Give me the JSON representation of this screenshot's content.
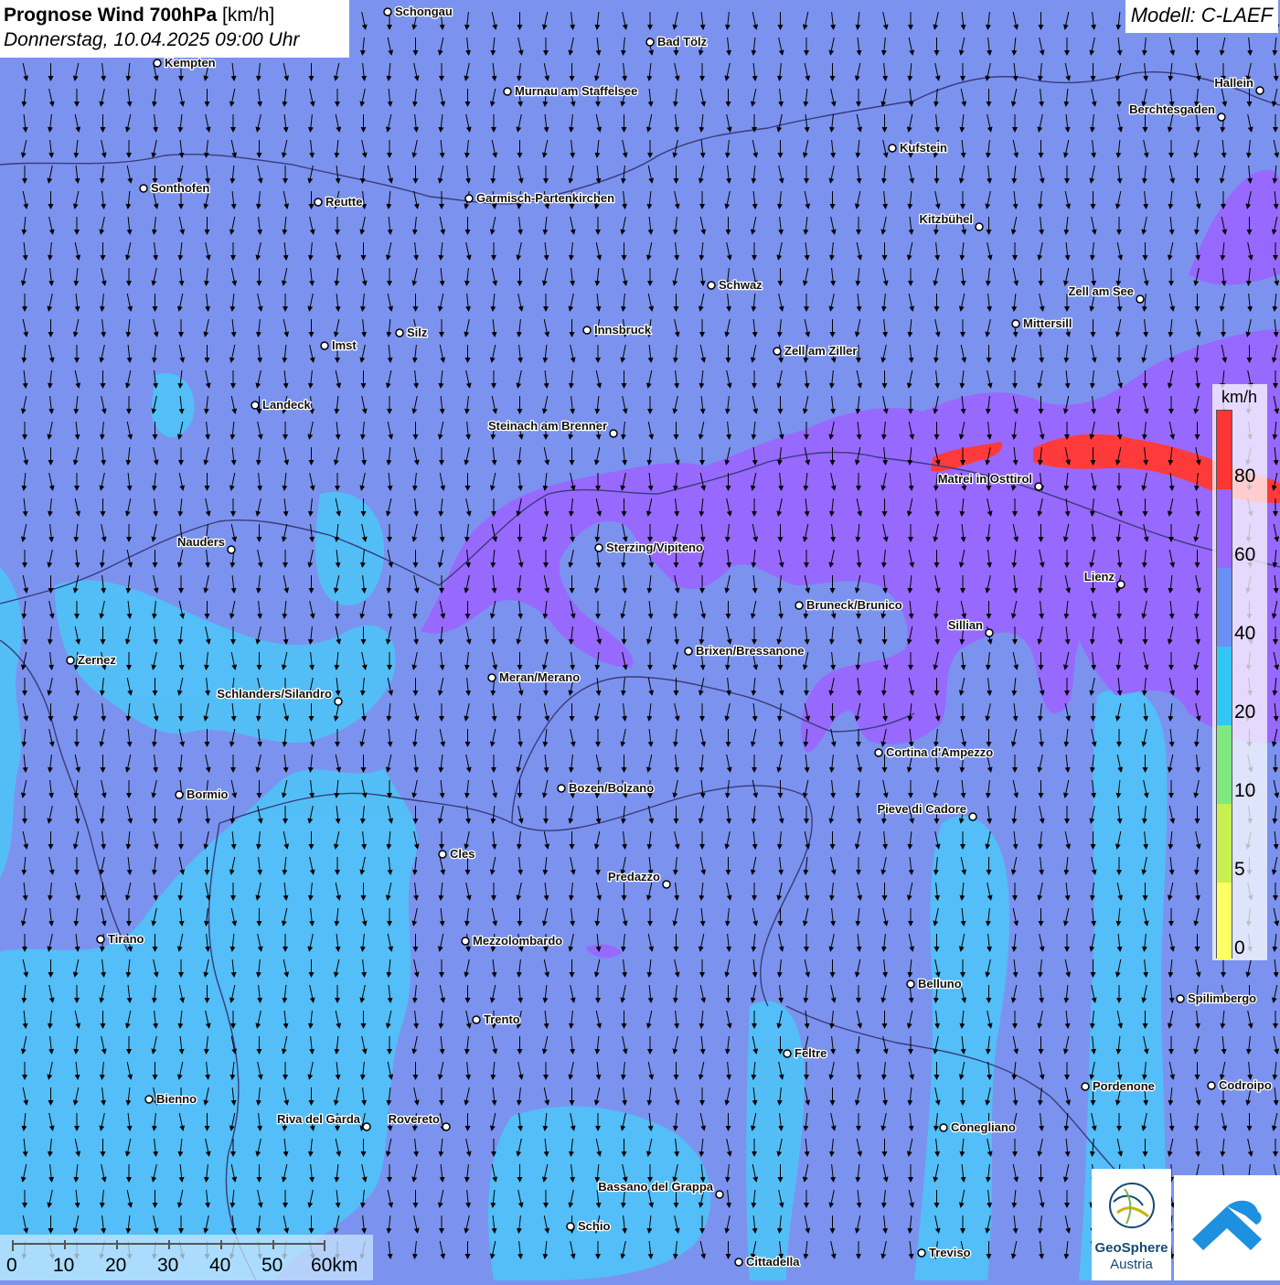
{
  "title": {
    "main_bold": "Prognose Wind 700hPa",
    "main_unit": "[km/h]",
    "datetime": "Donnerstag, 10.04.2025 09:00 Uhr"
  },
  "model": "Modell: C-LAEF",
  "legend": {
    "unit": "km/h",
    "ticks": [
      "80",
      "60",
      "40",
      "20",
      "10",
      "5",
      "0"
    ],
    "colors": [
      "#ff3434",
      "#9966ff",
      "#6b8ff2",
      "#33c6f5",
      "#7fe880",
      "#c8f050",
      "#ffff66"
    ]
  },
  "wind": {
    "direction": "north",
    "arrow_color": "#000000"
  },
  "map_colors": {
    "base": "#7b93ee",
    "light": "#4fc3f7",
    "mid": "#6fa8f5",
    "purple": "#9966ff",
    "red": "#ff3a3a",
    "border": "#3a3a7a"
  },
  "cities": [
    {
      "name": "Schongau"
    },
    {
      "name": "Bad Tölz"
    },
    {
      "name": "Kempten"
    },
    {
      "name": "Hallein"
    },
    {
      "name": "Murnau am Staffelsee"
    },
    {
      "name": "Berchtesgaden"
    },
    {
      "name": "Kufstein"
    },
    {
      "name": "Sonthofen"
    },
    {
      "name": "Reutte"
    },
    {
      "name": "Garmisch-Partenkirchen"
    },
    {
      "name": "Kitzbühel"
    },
    {
      "name": "Schwaz"
    },
    {
      "name": "Zell am See"
    },
    {
      "name": "Mittersill"
    },
    {
      "name": "Innsbruck"
    },
    {
      "name": "Silz"
    },
    {
      "name": "Imst"
    },
    {
      "name": "Zell am Ziller"
    },
    {
      "name": "Landeck"
    },
    {
      "name": "Steinach am Brenner"
    },
    {
      "name": "Matrei in Osttirol"
    },
    {
      "name": "Nauders"
    },
    {
      "name": "Sterzing/Vipiteno"
    },
    {
      "name": "Lienz"
    },
    {
      "name": "Bruneck/Brunico"
    },
    {
      "name": "Sillian"
    },
    {
      "name": "Zernez"
    },
    {
      "name": "Brixen/Bressanone"
    },
    {
      "name": "Meran/Merano"
    },
    {
      "name": "Schlanders/Silandro"
    },
    {
      "name": "Cortina d'Ampezzo"
    },
    {
      "name": "Bozen/Bolzano"
    },
    {
      "name": "Bormio"
    },
    {
      "name": "Pieve di Cadore"
    },
    {
      "name": "Cles"
    },
    {
      "name": "Predazzo"
    },
    {
      "name": "Tirano"
    },
    {
      "name": "Mezzolombardo"
    },
    {
      "name": "Belluno"
    },
    {
      "name": "Spilimbergo"
    },
    {
      "name": "Trento"
    },
    {
      "name": "Feltre"
    },
    {
      "name": "Pordenone"
    },
    {
      "name": "Codroipo"
    },
    {
      "name": "Bienno"
    },
    {
      "name": "Riva del Garda"
    },
    {
      "name": "Rovereto"
    },
    {
      "name": "Conegliano"
    },
    {
      "name": "Bassano del Grappa"
    },
    {
      "name": "Schio"
    },
    {
      "name": "Treviso"
    },
    {
      "name": "Cittadella"
    }
  ],
  "scale_bar": {
    "labels": [
      "0",
      "10",
      "20",
      "30",
      "40",
      "50",
      "60km"
    ]
  },
  "logos": {
    "geosphere_name": "GeoSphere",
    "geosphere_sub": "Austria"
  }
}
